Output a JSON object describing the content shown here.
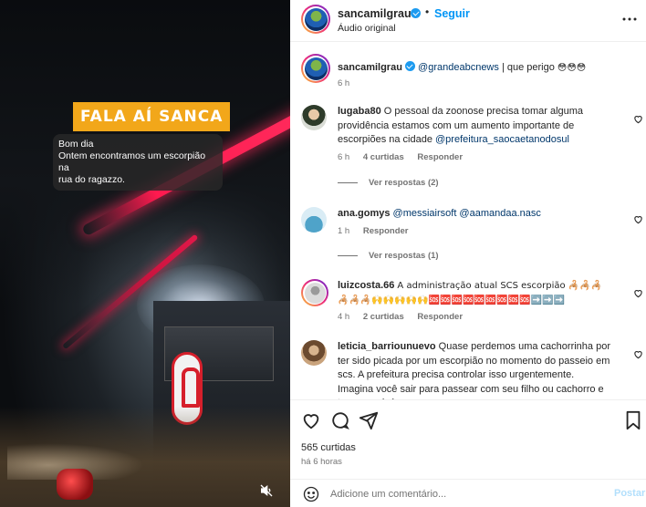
{
  "video": {
    "overlay_title": "FALA AÍ SANCA",
    "caption_lines": [
      "Bom dia",
      "Ontem encontramos um escorpião na",
      "rua do ragazzo."
    ]
  },
  "header": {
    "username": "sancamilgrau",
    "dot": "•",
    "follow_label": "Seguir",
    "audio_label": "Áudio original"
  },
  "post_caption": {
    "username": "sancamilgrau",
    "mention": "@grandeabcnews",
    "text": " | que perigo ",
    "emojis": "😳😳😳",
    "time": "6 h"
  },
  "comments": [
    {
      "username": "lugaba80",
      "text": "O pessoal da zoonose precisa tomar alguma providência estamos com um aumento importante de escorpiões na cidade ",
      "mention": "@prefeitura_saocaetanodosul",
      "time": "6 h",
      "likes": "4 curtidas",
      "reply": "Responder",
      "view_replies": "Ver respostas (2)"
    },
    {
      "username": "ana.gomys",
      "text": " ",
      "mention": "@messiairsoft @aamandaa.nasc",
      "time": "1 h",
      "reply": "Responder",
      "view_replies": "Ver respostas (1)"
    },
    {
      "username": "luizcosta.66",
      "text": "A administração atual SCS escorpião 🦂🦂🦂🦂🦂🦂🙌🙌🙌🙌🙌🆘🆘🆘🆘🆘🆘🆘🆘🆘➡️➡️➡️",
      "time": "4 h",
      "likes": "2 curtidas",
      "reply": "Responder"
    },
    {
      "username": "leticia_barriounuevo",
      "text": "Quase perdemos uma cachorrinha por ter sido picada por um escorpião no momento do passeio em scs. A prefeitura precisa controlar isso urgentemente. Imagina você sair para passear com seu filho ou cachorro e ter que sair às"
    }
  ],
  "actions": {
    "likes": "565 curtidas",
    "ago": "há 6 horas",
    "comment_placeholder": "Adicione um comentário...",
    "post_label": "Postar"
  },
  "colors": {
    "follow_blue": "#0095f6",
    "verified_blue": "#1d9bf0",
    "mention_blue": "#00376b",
    "tag_orange": "#f2a71a",
    "neon_red": "#ff1a4f"
  }
}
